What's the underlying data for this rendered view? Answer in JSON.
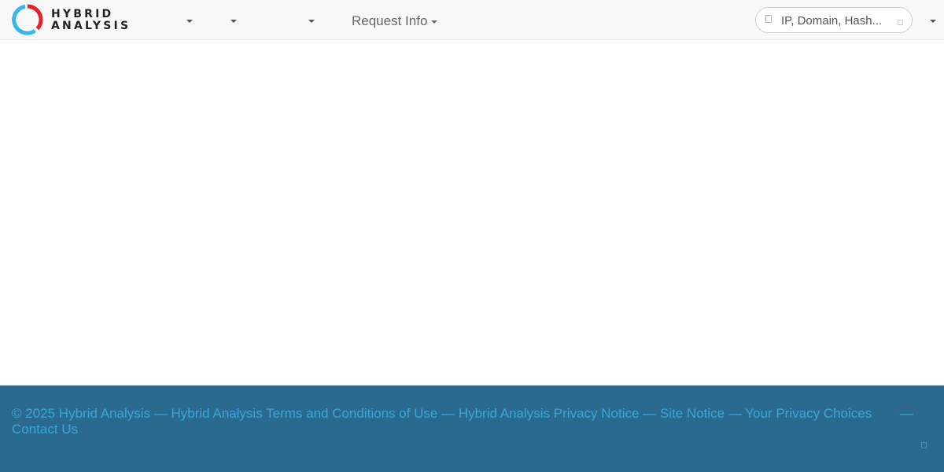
{
  "header": {
    "logo": {
      "line1": "HYBRID",
      "line2": "ANALYSIS",
      "ring_colors": [
        "#e8202a",
        "#36b8e8"
      ]
    },
    "nav": {
      "request_info_label": "Request Info"
    },
    "search": {
      "placeholder": "IP, Domain, Hash..."
    }
  },
  "footer": {
    "copyright": "© 2025 Hybrid Analysis",
    "separator": "—",
    "links": {
      "terms": "Hybrid Analysis Terms and Conditions of Use",
      "privacy": "Hybrid Analysis Privacy Notice",
      "site_notice": "Site Notice",
      "privacy_choices": "Your Privacy Choices",
      "contact": "Contact Us"
    }
  },
  "colors": {
    "footer_bg": "#2b6a8f",
    "footer_link": "#3aa5d8",
    "navbar_bg": "#f8f8f8"
  }
}
